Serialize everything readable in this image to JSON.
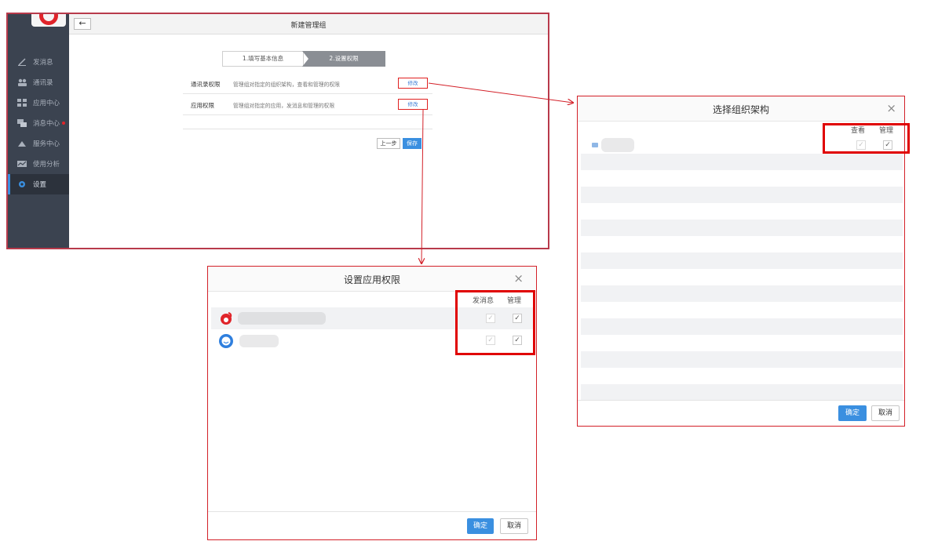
{
  "main": {
    "title": "新建管理组",
    "back_label": "←",
    "nav": [
      {
        "label": "发消息",
        "icon": "pencil-icon"
      },
      {
        "label": "通讯录",
        "icon": "contacts-icon"
      },
      {
        "label": "应用中心",
        "icon": "apps-icon"
      },
      {
        "label": "消息中心",
        "icon": "messages-icon",
        "dot": true
      },
      {
        "label": "服务中心",
        "icon": "service-icon"
      },
      {
        "label": "使用分析",
        "icon": "analytics-icon"
      },
      {
        "label": "设置",
        "icon": "gear-icon",
        "active": true
      }
    ],
    "steps": [
      "1.填写基本信息",
      "2.设置权限"
    ],
    "perms": [
      {
        "label": "通讯录权限",
        "desc": "管理组对指定的组织架构，查看和管理的权限",
        "action": "修改"
      },
      {
        "label": "应用权限",
        "desc": "管理组对指定的应用，发消息和管理的权限",
        "action": "修改"
      }
    ],
    "prev_label": "上一步",
    "save_label": "保存"
  },
  "org_dialog": {
    "title": "选择组织架构",
    "col_view": "查看",
    "col_manage": "管理",
    "confirm": "确定",
    "cancel": "取消",
    "close": "×"
  },
  "app_dialog": {
    "title": "设置应用权限",
    "col_send": "发消息",
    "col_manage": "管理",
    "confirm": "确定",
    "cancel": "取消",
    "close": "×"
  },
  "check_mark": "✓",
  "colors": {
    "accent": "#3a8fe0",
    "sidebar": "#3b4350",
    "highlight": "#e00000",
    "brand_red": "#e0242a"
  }
}
